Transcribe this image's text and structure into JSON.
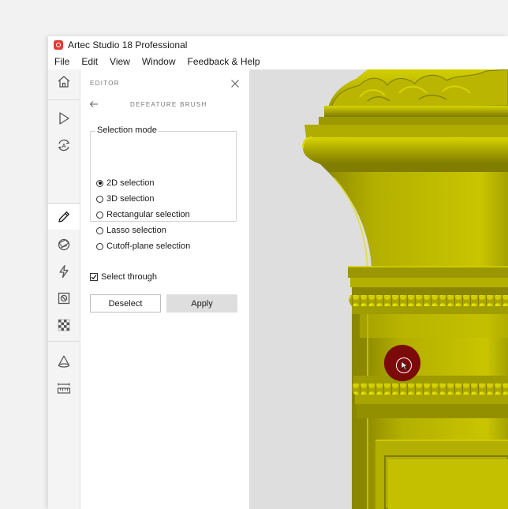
{
  "window": {
    "title": "Artec Studio 18 Professional"
  },
  "menu": [
    "File",
    "Edit",
    "View",
    "Window",
    "Feedback & Help"
  ],
  "toolbar": {
    "tools": [
      {
        "name": "home-icon",
        "active": false
      },
      {
        "name": "play-icon",
        "active": false
      },
      {
        "name": "autopilot-icon",
        "active": false
      },
      {
        "name": "pencil-icon",
        "active": true
      },
      {
        "name": "texture-icon",
        "active": false
      },
      {
        "name": "lightning-icon",
        "active": false
      },
      {
        "name": "fix-icon",
        "active": false
      },
      {
        "name": "checkerboard-icon",
        "active": false
      },
      {
        "name": "cone-icon",
        "active": false
      },
      {
        "name": "measure-icon",
        "active": false
      }
    ]
  },
  "panel": {
    "header": "EDITOR",
    "subtitle": "DEFEATURE BRUSH",
    "selection_mode": {
      "legend": "Selection mode",
      "options": [
        {
          "label": "2D selection",
          "checked": true
        },
        {
          "label": "3D selection",
          "checked": false
        },
        {
          "label": "Rectangular selection",
          "checked": false
        },
        {
          "label": "Lasso selection",
          "checked": false
        },
        {
          "label": "Cutoff-plane selection",
          "checked": false
        }
      ]
    },
    "select_through": {
      "label": "Select through",
      "checked": true
    },
    "buttons": {
      "deselect": "Deselect",
      "apply": "Apply"
    }
  },
  "colors": {
    "model": "#b8b400",
    "brush": "#7d0a0a",
    "accent": "#e53935"
  }
}
